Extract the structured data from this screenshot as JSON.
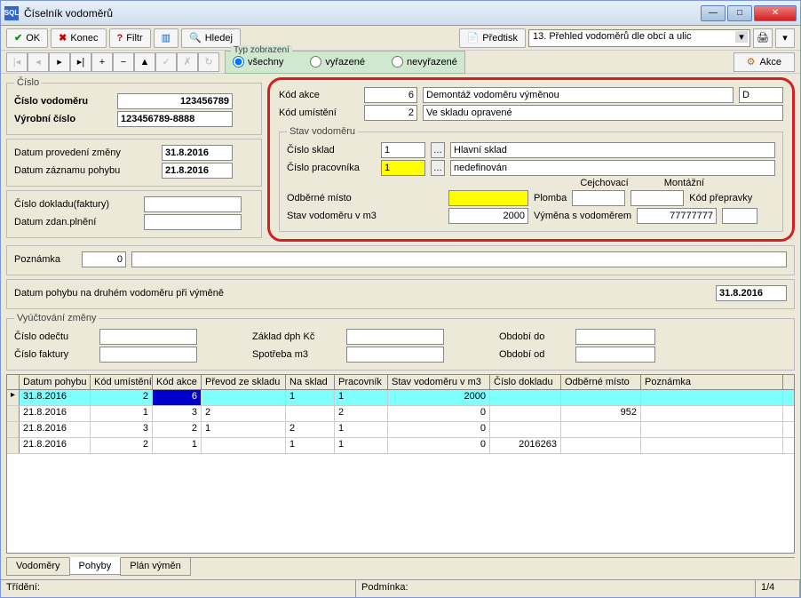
{
  "window": {
    "title": "Číselník vodoměrů"
  },
  "toolbar": {
    "ok": "OK",
    "konec": "Konec",
    "filtr": "Filtr",
    "hledej": "Hledej",
    "predtisk": "Předtisk",
    "dropdown": "13. Přehled vodoměrů dle obcí a ulic"
  },
  "display": {
    "legend": "Typ zobrazení",
    "vsechny": "všechny",
    "vyrazene": "vyřazené",
    "nevyrazene": "nevyřazené",
    "akce": "Akce"
  },
  "cislo": {
    "legend": "Číslo",
    "cislo_vodomeru_lbl": "Číslo vodoměru",
    "cislo_vodomeru": "123456789",
    "vyrobni_cislo_lbl": "Výrobní číslo",
    "vyrobni_cislo": "123456789-8888"
  },
  "dates": {
    "datum_provedeni_lbl": "Datum provedení změny",
    "datum_provedeni": "31.8.2016",
    "datum_zaznamu_lbl": "Datum záznamu pohybu",
    "datum_zaznamu": "21.8.2016"
  },
  "doklad": {
    "cislo_dokladu_lbl": "Číslo dokladu(faktury)",
    "datum_zdan_lbl": "Datum zdan.plnění"
  },
  "action": {
    "kod_akce_lbl": "Kód akce",
    "kod_akce": "6",
    "kod_akce_text": "Demontáž vodoměru výměnou",
    "kod_akce_suffix": "D",
    "kod_umisteni_lbl": "Kód umístění",
    "kod_umisteni": "2",
    "kod_umisteni_text": "Ve skladu opravené"
  },
  "stav": {
    "legend": "Stav vodoměru",
    "cislo_sklad_lbl": "Číslo sklad",
    "cislo_sklad": "1",
    "cislo_sklad_text": "Hlavní sklad",
    "cislo_pracovnika_lbl": "Číslo pracovníka",
    "cislo_pracovnika": "1",
    "cislo_pracovnika_text": "nedefinován",
    "cejchovaci_lbl": "Cejchovací",
    "montazni_lbl": "Montážní",
    "odberne_misto_lbl": "Odběrné místo",
    "plomba_lbl": "Plomba",
    "kod_prepravky_lbl": "Kód přepravky",
    "stav_m3_lbl": "Stav vodoměru v m3",
    "stav_m3": "2000",
    "vymena_lbl": "Výměna s vodoměrem",
    "vymena": "77777777"
  },
  "poznamka": {
    "lbl": "Poznámka",
    "val": "0"
  },
  "pohyb2": {
    "lbl": "Datum pohybu na druhém vodoměru při výměně",
    "val": "31.8.2016"
  },
  "vyuct": {
    "legend": "Vyúčtování změny",
    "cislo_odectu_lbl": "Číslo odečtu",
    "zaklad_lbl": "Základ dph Kč",
    "obdobi_do_lbl": "Období do",
    "cislo_faktury_lbl": "Číslo faktury",
    "spotreba_lbl": "Spotřeba m3",
    "obdobi_od_lbl": "Období od"
  },
  "grid": {
    "headers": [
      "Datum pohybu",
      "Kód umístění",
      "Kód akce",
      "Převod ze skladu",
      "Na sklad",
      "Pracovník",
      "Stav vodoměru v m3",
      "Číslo dokladu",
      "Odběrné místo",
      "Poznámka"
    ],
    "rows": [
      {
        "datum": "31.8.2016",
        "umist": "2",
        "akce": "6",
        "ze": "",
        "na": "1",
        "prac": "1",
        "stav": "2000",
        "doklad": "",
        "odb": "",
        "pozn": ""
      },
      {
        "datum": "21.8.2016",
        "umist": "1",
        "akce": "3",
        "ze": "2",
        "na": "",
        "prac": "2",
        "stav": "0",
        "doklad": "",
        "odb": "952",
        "pozn": ""
      },
      {
        "datum": "21.8.2016",
        "umist": "3",
        "akce": "2",
        "ze": "1",
        "na": "2",
        "prac": "1",
        "stav": "0",
        "doklad": "",
        "odb": "",
        "pozn": ""
      },
      {
        "datum": "21.8.2016",
        "umist": "2",
        "akce": "1",
        "ze": "",
        "na": "1",
        "prac": "1",
        "stav": "0",
        "doklad": "2016263",
        "odb": "",
        "pozn": ""
      }
    ]
  },
  "tabs": {
    "t1": "Vodoměry",
    "t2": "Pohyby",
    "t3": "Plán výměn"
  },
  "status": {
    "trideni": "Třídění:",
    "podminka": "Podmínka:",
    "page": "1/4"
  }
}
